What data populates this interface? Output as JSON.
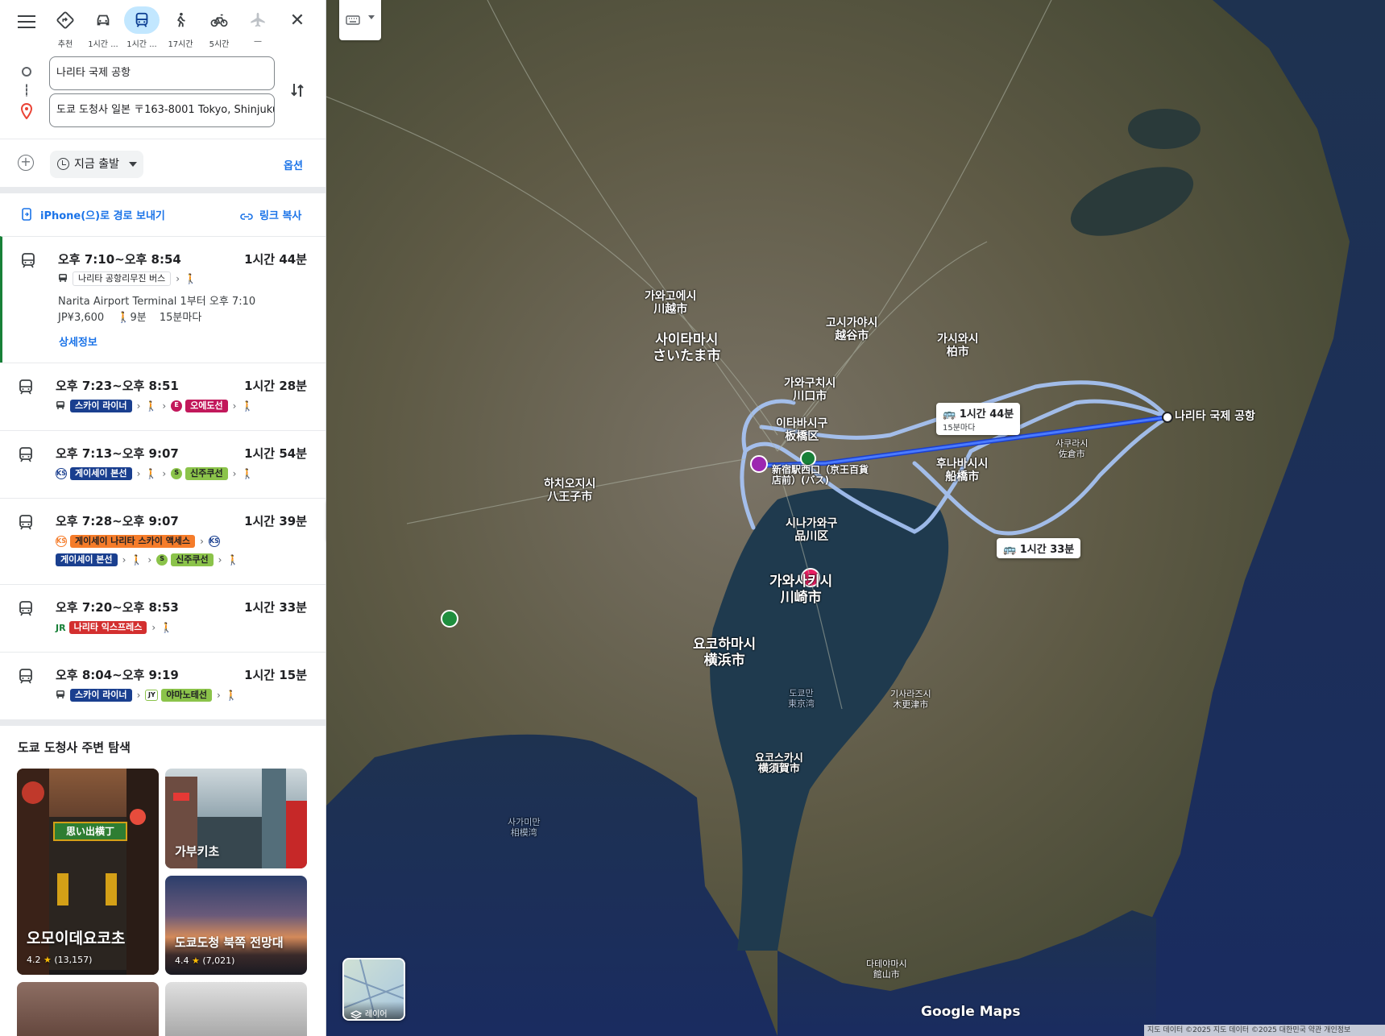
{
  "modes": [
    {
      "icon": "best-route-icon",
      "label": "추천"
    },
    {
      "icon": "car-icon",
      "label": "1시간 ..."
    },
    {
      "icon": "transit-icon",
      "label": "1시간 ..."
    },
    {
      "icon": "walk-icon",
      "label": "17시간"
    },
    {
      "icon": "bike-icon",
      "label": "5시간"
    },
    {
      "icon": "flight-icon",
      "label": "—"
    }
  ],
  "origin": "나리타 국제 공항",
  "destination": "도쿄 도청사 일본 〒163-8001 Tokyo, Shinjuku",
  "depart_label": "지금 출발",
  "options_label": "옵션",
  "send_label": "iPhone(으)로 경로 보내기",
  "copy_label": "링크 복사",
  "routes": [
    {
      "time": "오후 7:10~오후 8:54",
      "duration": "1시간 44분",
      "step1": "나리타 공항리무진 버스",
      "info": "Narita Airport Terminal 1부터 오후 7:10",
      "fare": "JP¥3,600",
      "walk": "9분",
      "freq": "15분마다",
      "detail": "상세정보"
    },
    {
      "time": "오후 7:23~오후 8:51",
      "duration": "1시간 28분",
      "step1": "스카이 라이너",
      "step1_color": "#1a3f8f",
      "step2": "오에도선",
      "step2_icon": "E",
      "step2_color": "#c2185b"
    },
    {
      "time": "오후 7:13~오후 9:07",
      "duration": "1시간 54분",
      "step1": "게이세이 본선",
      "step1_icon": "KS",
      "step1_color": "#1a3f8f",
      "step2": "신주쿠선",
      "step2_icon": "S",
      "step2_color": "#8bc34a"
    },
    {
      "time": "오후 7:28~오후 9:07",
      "duration": "1시간 39분",
      "step1": "게이세이 나리타 스카이 액세스",
      "step1_icon": "KS",
      "step1_color": "#f57c2a",
      "step1b_icon": "KS",
      "step2": "게이세이 본선",
      "step2_color": "#1a3f8f",
      "step3": "신주쿠선",
      "step3_icon": "S",
      "step3_color": "#8bc34a"
    },
    {
      "time": "오후 7:20~오후 8:53",
      "duration": "1시간 33분",
      "step1_prefix": "JR",
      "step1": "나리타 익스프레스",
      "step1_color": "#d32f2f"
    },
    {
      "time": "오후 8:04~오후 9:19",
      "duration": "1시간 15분",
      "step1": "스카이 라이너",
      "step1_color": "#1a3f8f",
      "step2": "야마노테선",
      "step2_icon": "JY",
      "step2_color": "#8bc34a"
    }
  ],
  "explore_title": "도쿄 도청사 주변 탐색",
  "places": [
    {
      "name": "오모이데요코초",
      "rating": "4.2",
      "reviews": "(13,157)",
      "sign": "思い出横丁"
    },
    {
      "name": "가부키초"
    },
    {
      "name": "도쿄도청 북쪽 전망대",
      "rating": "4.4",
      "reviews": "(7,021)"
    }
  ],
  "map": {
    "duration_box_1": {
      "time": "1시간 44분",
      "sub": "15분마다"
    },
    "duration_box_2": {
      "time": "1시간 33분"
    },
    "origin_label": "나리타 국제 공항",
    "dest_label": "新宿駅西口（京王百貨店前）(バス)",
    "layer_label": "레이어",
    "brand": "Google Maps",
    "footer": "지도 데이터 ©2025 지도 데이터 ©2025   대한민국   약관   개인정보",
    "places": {
      "saitama": "사이타마시\nさいたま市",
      "kawasaki": "가와사키시\n川崎市",
      "yokohama": "요코하마시\n横浜市",
      "funabashi": "후나바시시\n船橋市",
      "kashiwa": "가시와시\n柏市",
      "kawaguchi": "가와구치시\n川口市",
      "itabashi": "이타바시구\n板橋区",
      "shinagawa": "시나가와구\n品川区",
      "hachioji": "하치오지시\n八王子市",
      "kawagoe": "가와고에시\n川越市",
      "koshigaya": "고시가야시\n越谷市",
      "yokosuka": "요코스카시\n横須賀市",
      "chiba_sakura": "사쿠라시\n佐倉市",
      "tateyama": "다테야마시\n館山市",
      "kisarazu": "기사라즈시\n木更津市",
      "sagamihara": "사가미만\n相模湾",
      "tokyo_bay": "도쿄만\n東京湾"
    }
  }
}
